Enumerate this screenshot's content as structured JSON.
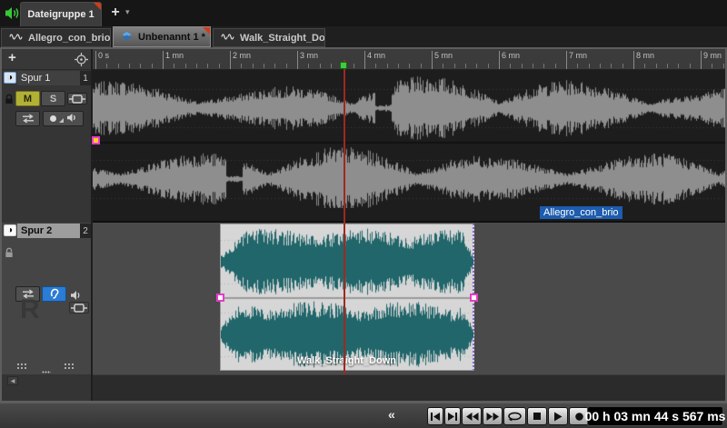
{
  "top_bar": {
    "group_tab_label": "Dateigruppe 1",
    "add_tab_label": "+",
    "add_tab_caret": "▾"
  },
  "doc_tabs": {
    "tab1": {
      "label": "Allegro_con_brio"
    },
    "tab2": {
      "label": "Unbenannt 1 *"
    },
    "tab3": {
      "label": "Walk_Straight_Down"
    }
  },
  "track_panel": {
    "add_track_label": "+",
    "scroll_left_label": "◀"
  },
  "tracks": {
    "track1": {
      "name": "Spur 1",
      "number": "1",
      "mute_label": "M",
      "solo_label": "S"
    },
    "track2": {
      "name": "Spur 2",
      "number": "2",
      "arm_letter": "R"
    }
  },
  "ruler": {
    "labels": [
      "0 s",
      "1 mn",
      "2 mn",
      "3 mn",
      "4 mn",
      "5 mn",
      "6 mn",
      "7 mn",
      "8 mn",
      "9 mn"
    ]
  },
  "clips": {
    "track1_clip_name": "Allegro_con_brio",
    "track2_clip_name": "Walk_Straight_Down"
  },
  "transport": {
    "collapse_label": "«",
    "button_icons": [
      "go-to-start",
      "go-to-end",
      "rewind",
      "fast-forward",
      "loop",
      "stop",
      "play",
      "record"
    ],
    "time_display": "00 h 03 mn 44 s 567 ms"
  },
  "colors": {
    "mute_active": "#b2b135",
    "monitor_active": "#2b7cd4",
    "clip_waveform_teal": "#20666a",
    "track1_waveform_gray": "#8e8e8e",
    "playhead_red": "#a02820",
    "locator_green": "#41c944",
    "clip_label_blue": "#1d5cae",
    "tab_corner_red": "#d23b18"
  }
}
